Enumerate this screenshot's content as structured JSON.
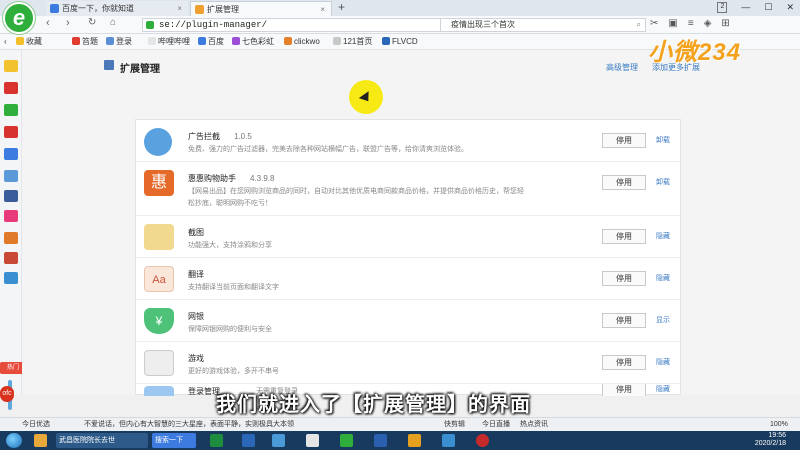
{
  "tabs": [
    {
      "label": "百度一下，你就知道"
    },
    {
      "label": "扩展管理"
    }
  ],
  "tab_new": "+",
  "window_controls": [
    "2",
    "—",
    "☐",
    "✕"
  ],
  "address": {
    "url": "se://plugin-manager/"
  },
  "search": {
    "value": "疫情出现三个首次"
  },
  "bookmarks": [
    "收藏",
    "笞题",
    "登录",
    "哔哩哔哩",
    "百度",
    "七色彩虹",
    "clickwo",
    "121首页",
    "FLVCD"
  ],
  "brand": "小微234",
  "page": {
    "title": "扩展管理",
    "links": [
      "高级管理",
      "添加更多扩展"
    ]
  },
  "extensions": [
    {
      "name": "广告拦截",
      "version": "1.0.5",
      "desc": "免费、强力的广告过滤器，完美去除各种网站横幅广告，联盟广告等，给你清爽浏览体验。",
      "button": "停用",
      "action": "卸载",
      "color": "#5aa1e0"
    },
    {
      "name": "惠惠购物助手",
      "version": "4.3.9.8",
      "desc": "【网易出品】在您网购浏览商品的同时，自动对比其他优质电商同款商品价格，并提供商品价格历史，帮您轻松抄底，聪明网购不吃亏！",
      "button": "停用",
      "action": "卸载",
      "color": "#e56a2a"
    },
    {
      "name": "截图",
      "version": "",
      "desc": "功能强大，支持涂鸦和分享",
      "button": "停用",
      "action": "隐藏",
      "color": "#f2d990"
    },
    {
      "name": "翻译",
      "version": "",
      "desc": "支持翻译当前页面和翻译文字",
      "button": "停用",
      "action": "隐藏",
      "color": "#fbe7d9"
    },
    {
      "name": "网银",
      "version": "",
      "desc": "保障网银网购的便利与安全",
      "button": "停用",
      "action": "显示",
      "color": "#4fc27a"
    },
    {
      "name": "游戏",
      "version": "",
      "desc": "更好的游戏体验，多开不串号",
      "button": "停用",
      "action": "隐藏",
      "color": "#eeeeee"
    },
    {
      "name": "登录管理",
      "version": "",
      "desc": "无需重复登录",
      "button": "停用",
      "action": "隐藏",
      "color": "#9cc7f0"
    }
  ],
  "subtitle": "我们就进入了【扩展管理】的界面",
  "statusbar": [
    "今日优选",
    "不爱说话，但内心有大智慧的三大星座，表面平静，实则极具大本领",
    "快剪辑",
    "今日直播",
    "热点资讯",
    "100%"
  ],
  "taskbar": {
    "items": [
      "武昌医院院长去世",
      "搜索一下"
    ],
    "time": "19:56",
    "date": "2020/2/18"
  },
  "sidebar_labels": [
    "热门",
    "ofc"
  ]
}
